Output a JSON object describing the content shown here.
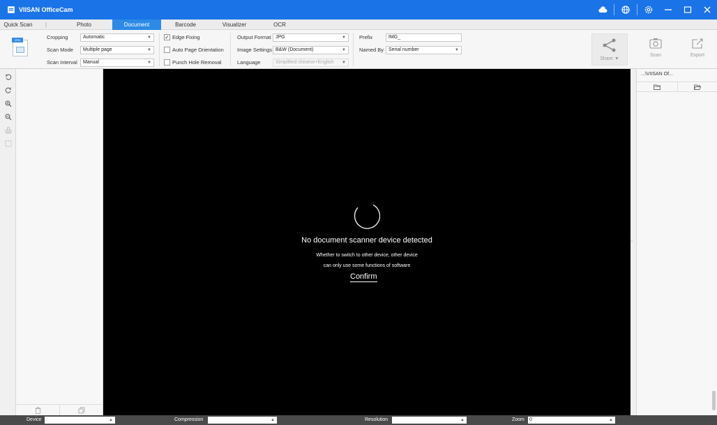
{
  "window": {
    "title": "VIISAN OfficeCam"
  },
  "titlebar_icons": [
    "cloud-icon",
    "globe-icon",
    "settings-icon",
    "minimize-icon",
    "maximize-icon",
    "close-icon"
  ],
  "tabs": [
    {
      "label": "Quick Scan",
      "active": false
    },
    {
      "label": "|",
      "active": false
    },
    {
      "label": "Photo",
      "active": false
    },
    {
      "label": "Document",
      "active": true
    },
    {
      "label": "Barcode",
      "active": false
    },
    {
      "label": "Visualizer",
      "active": false
    },
    {
      "label": "OCR",
      "active": false
    }
  ],
  "toolbar": {
    "format_badge": "JPG",
    "cropping": {
      "label": "Cropping",
      "value": "Automatic"
    },
    "scan_mode": {
      "label": "Scan Mode",
      "value": "Multiple page"
    },
    "scan_interval": {
      "label": "Scan Interval",
      "value": "Manual"
    },
    "edge_fixing": {
      "label": "Edge Fixing",
      "checked": true
    },
    "auto_orientation": {
      "label": "Auto Page Orientation",
      "checked": false
    },
    "punch_hole": {
      "label": "Punch Hole Removal",
      "checked": false
    },
    "output_format": {
      "label": "Output Format",
      "value": "JPG"
    },
    "image_settings": {
      "label": "Image Settings",
      "value": "B&W (Document)"
    },
    "language": {
      "label": "Language",
      "value": "Simplified chinese+English"
    },
    "prefix": {
      "label": "Prefix",
      "value": "IMG_"
    },
    "named_by": {
      "label": "Named By",
      "value": "Serial number"
    },
    "share_label": "Share ▼",
    "scan_label": "Scan",
    "export_label": "Export"
  },
  "viewer": {
    "title": "No document scanner device detected",
    "line1": "Whether to switch to other device, other device",
    "line2": "can only use some functions of software",
    "confirm": "Confirm"
  },
  "right_panel": {
    "path": "...\\VIISAN Of..."
  },
  "statusbar": {
    "device_label": "Device",
    "device_value": "",
    "compression_label": "Compression",
    "compression_value": "",
    "resolution_label": "Resolution",
    "resolution_value": "",
    "zoom_label": "Zoom",
    "zoom_value": "0"
  }
}
